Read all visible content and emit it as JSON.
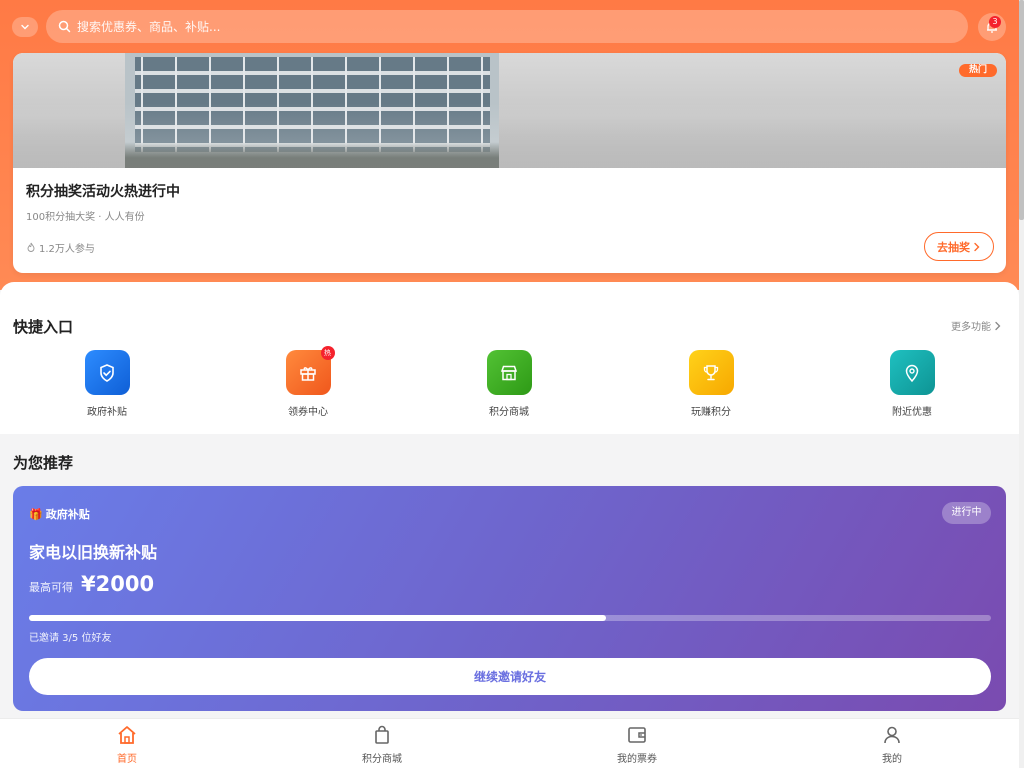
{
  "header": {
    "search_placeholder": "搜索优惠券、商品、补贴...",
    "notification_count": "3"
  },
  "banner": {
    "tag": "热门",
    "title": "积分抽奖活动火热进行中",
    "subtitle": "100积分抽大奖 · 人人有份",
    "participants": "1.2万人参与",
    "action_label": "去抽奖"
  },
  "quick_entry": {
    "title": "快捷入口",
    "more_label": "更多功能",
    "items": [
      {
        "label": "政府补贴",
        "icon": "shield-check-icon",
        "color": "#1677ff"
      },
      {
        "label": "领券中心",
        "icon": "gift-icon",
        "color": "#ff6a2b",
        "badge": "热"
      },
      {
        "label": "积分商城",
        "icon": "store-icon",
        "color": "#3fae2a"
      },
      {
        "label": "玩赚积分",
        "icon": "trophy-icon",
        "color": "#fbbf00"
      },
      {
        "label": "附近优惠",
        "icon": "location-pin-icon",
        "color": "#13a8a8"
      }
    ]
  },
  "recommend": {
    "title": "为您推荐",
    "card": {
      "tag": "政府补贴",
      "status": "进行中",
      "name": "家电以旧换新补贴",
      "amount_label": "最高可得",
      "amount": "¥2000",
      "invited_label": "已邀请 3/5 位好友",
      "progress": 0.6,
      "action_label": "继续邀请好友"
    }
  },
  "bottom_nav": {
    "items": [
      {
        "label": "首页",
        "icon": "home-icon",
        "active": true
      },
      {
        "label": "积分商城",
        "icon": "shopping-bag-icon",
        "active": false
      },
      {
        "label": "我的票券",
        "icon": "wallet-icon",
        "active": false
      },
      {
        "label": "我的",
        "icon": "user-icon",
        "active": false
      }
    ]
  },
  "colors": {
    "accent": "#ff6a2b",
    "header_gradient_start": "#ff7a45",
    "card_gradient_start": "#6a7de8",
    "card_gradient_end": "#7a4bb0"
  }
}
